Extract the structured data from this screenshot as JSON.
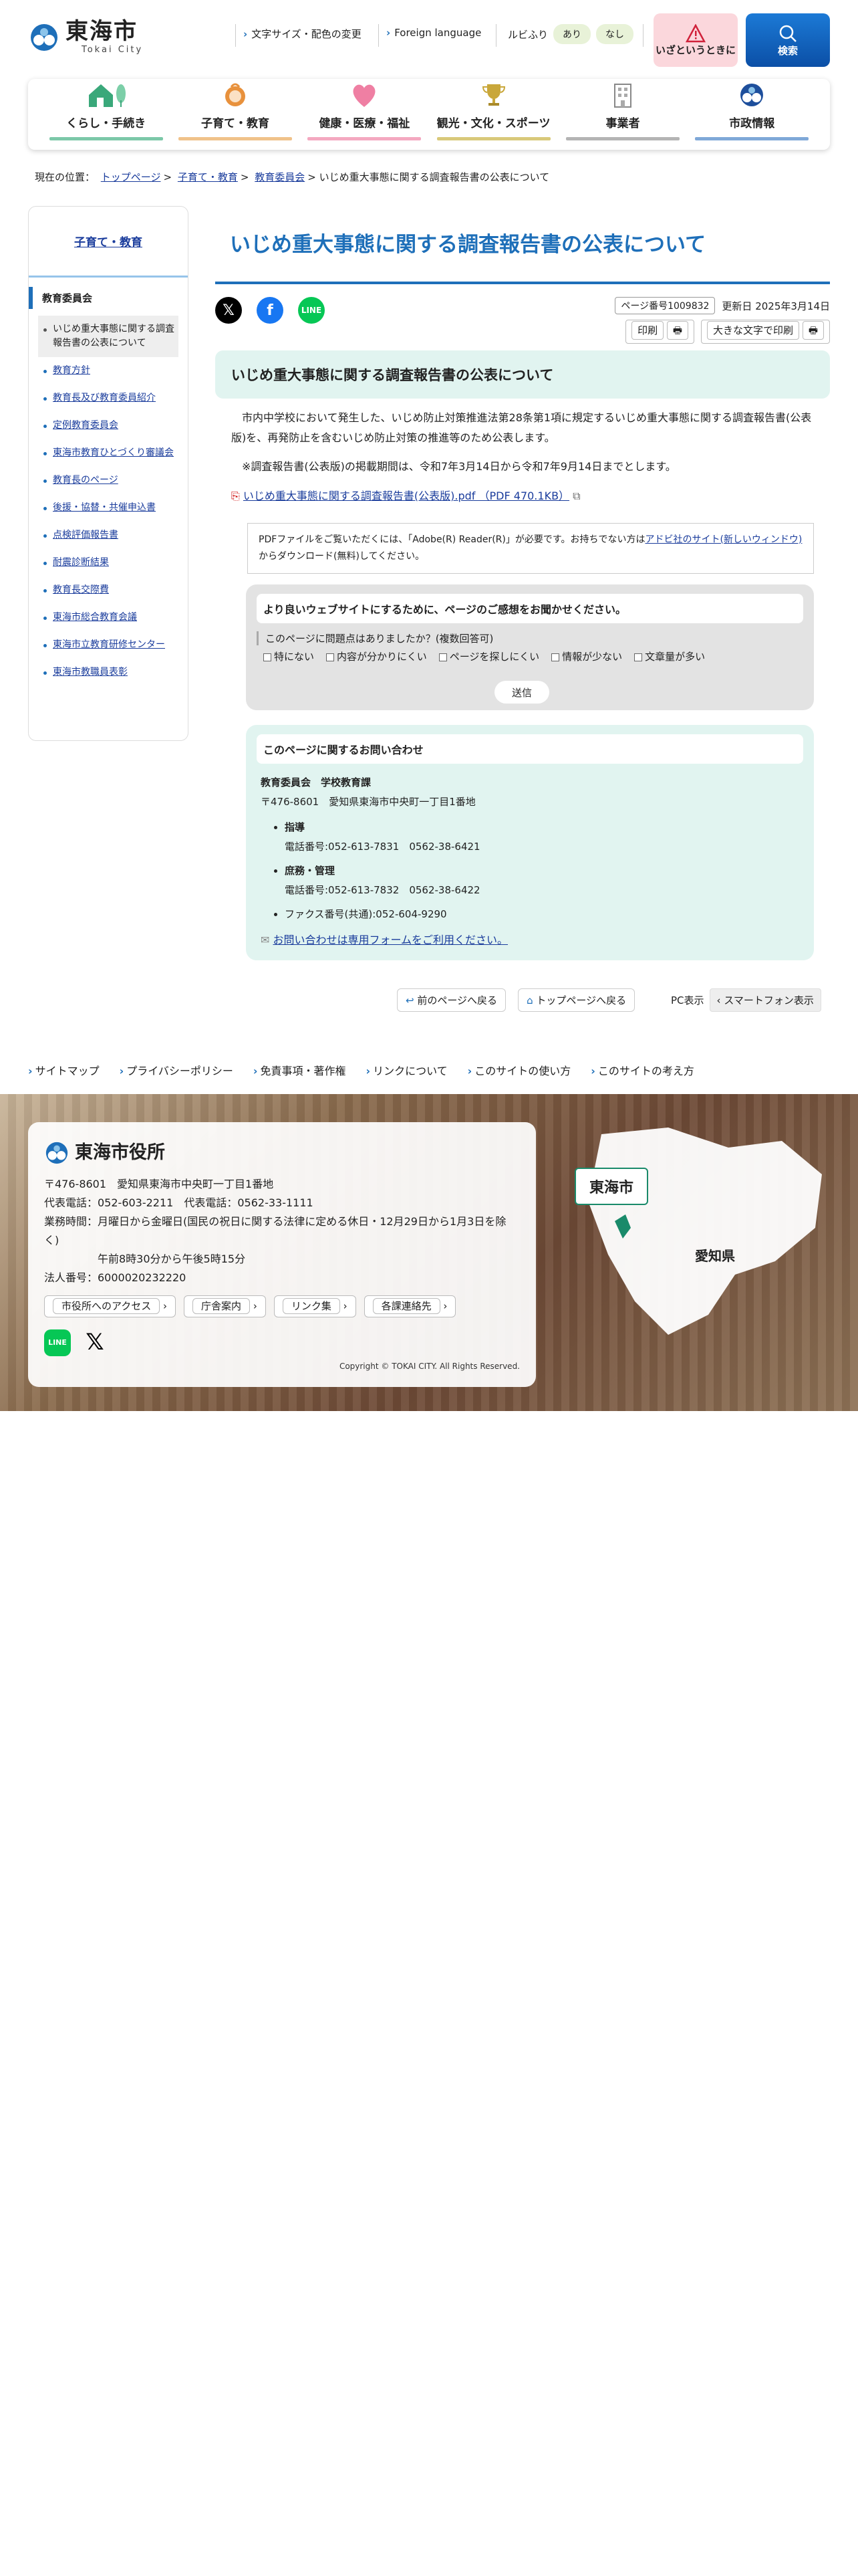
{
  "header": {
    "logo_jp": "東海市",
    "logo_en": "Tokai City",
    "text_size": "文字サイズ・配色の変更",
    "foreign": "Foreign language",
    "ruby_label": "ルビふり",
    "ruby_on": "あり",
    "ruby_off": "なし",
    "emergency": "いざというときに",
    "search": "検索"
  },
  "gnav": [
    {
      "label": "くらし・手続き",
      "color": "#7cc8a8"
    },
    {
      "label": "子育て・教育",
      "color": "#f0c28a"
    },
    {
      "label": "健康・医療・福祉",
      "color": "#f4a8c0"
    },
    {
      "label": "観光・文化・スポーツ",
      "color": "#d9c97a"
    },
    {
      "label": "事業者",
      "color": "#b4b4b4"
    },
    {
      "label": "市政情報",
      "color": "#7fa8d8"
    }
  ],
  "breadcrumb": {
    "prefix": "現在の位置：",
    "items": [
      "トップページ",
      "子育て・教育",
      "教育委員会"
    ],
    "current": "いじめ重大事態に関する調査報告書の公表について"
  },
  "sidebar": {
    "title": "子育て・教育",
    "section": "教育委員会",
    "items": [
      "いじめ重大事態に関する調査報告書の公表について",
      "教育方針",
      "教育長及び教育委員紹介",
      "定例教育委員会",
      "東海市教育ひとづくり審議会",
      "教育長のページ",
      "後援・協替・共催申込書",
      "点検評価報告書",
      "耐震診断結果",
      "教育長交際費",
      "東海市総合教育会議",
      "東海市立教育研修センター",
      "東海市教職員表彰"
    ]
  },
  "main": {
    "title": "いじめ重大事態に関する調査報告書の公表について",
    "page_no": "ページ番号1009832",
    "updated": "更新日 2025年3月14日",
    "print": "印刷",
    "print_large": "大きな文字で印刷",
    "h2": "いじめ重大事態に関する調査報告書の公表について",
    "para1": "市内中学校において発生した、いじめ防止対策推進法第28条第1項に規定するいじめ重大事態に関する調査報告書(公表版)を、再発防止を含むいじめ防止対策の推進等のため公表します。",
    "para2": "※調査報告書(公表版)の掲載期間は、令和7年3月14日から令和7年9月14日までとします。",
    "pdf_link": "いじめ重大事態に関する調査報告書(公表版).pdf （PDF 470.1KB）",
    "pdf_note_a": "PDFファイルをご覧いただくには、「Adobe(R) Reader(R)」が必要です。お持ちでない方は",
    "pdf_note_link": "アドビ社のサイト(新しいウィンドウ)",
    "pdf_note_b": "からダウンロード(無料)してください。"
  },
  "feedback": {
    "heading": "より良いウェブサイトにするために、ページのご感想をお聞かせください。",
    "question": "このページに問題点はありましたか？(複数回答可)",
    "options": [
      "特にない",
      "内容が分かりにくい",
      "ページを探しにくい",
      "情報が少ない",
      "文章量が多い"
    ],
    "submit": "送信"
  },
  "contact": {
    "heading": "このページに関するお問い合わせ",
    "dept": "教育委員会　学校教育課",
    "address": "〒476-8601　愛知県東海市中央町一丁目1番地",
    "items": [
      {
        "name": "指導",
        "tel": "電話番号:052-613-7831　0562-38-6421"
      },
      {
        "name": "庶務・管理",
        "tel": "電話番号:052-613-7832　0562-38-6422"
      }
    ],
    "fax": "ファクス番号(共通):052-604-9290",
    "form_link": "お問い合わせは専用フォームをご利用ください。"
  },
  "pagenav": {
    "back": "前のページへ戻る",
    "top": "トップページへ戻る",
    "pc": "PC表示",
    "sp": "スマートフォン表示"
  },
  "footer_nav": [
    "サイトマップ",
    "プライバシーポリシー",
    "免責事項・著作権",
    "リンクについて",
    "このサイトの使い方",
    "このサイトの考え方"
  ],
  "footer": {
    "name": "東海市役所",
    "address": "〒476-8601　愛知県東海市中央町一丁目1番地",
    "tel": "代表電話：052-603-2211　代表電話：0562-33-1111",
    "hours1": "業務時間：月曜日から金曜日(国民の祝日に関する法律に定める休日・12月29日から1月3日を除く)",
    "hours2": "午前8時30分から午後5時15分",
    "corp": "法人番号：6000020232220",
    "links": [
      "市役所へのアクセス",
      "庁舎案内",
      "リンク集",
      "各課連絡先"
    ],
    "copyright": "Copyright © TOKAI CITY. All Rights Reserved.",
    "map_city": "東海市",
    "map_pref": "愛知県"
  }
}
